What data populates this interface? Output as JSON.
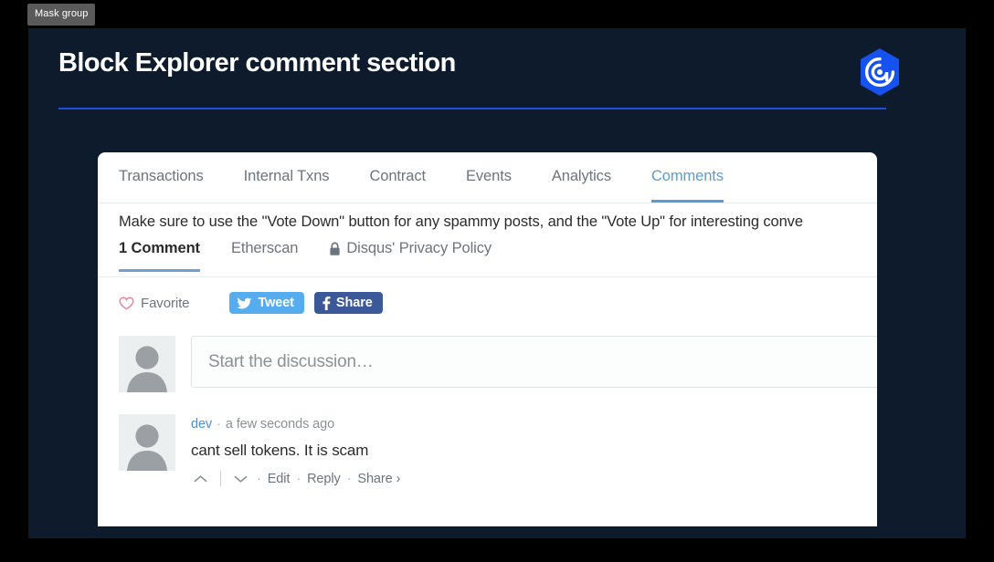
{
  "tooltip": {
    "label": "Mask group"
  },
  "panel": {
    "title": "Block Explorer comment section",
    "background_color": "#0d1b2d",
    "rule_color": "#1d4ed8",
    "logo_name": "brand-hexagon-logo",
    "logo_color": "#1652f0"
  },
  "card": {
    "tabs": [
      {
        "label": "Transactions",
        "active": false
      },
      {
        "label": "Internal Txns",
        "active": false
      },
      {
        "label": "Contract",
        "active": false
      },
      {
        "label": "Events",
        "active": false
      },
      {
        "label": "Analytics",
        "active": false
      },
      {
        "label": "Comments",
        "active": true
      }
    ],
    "active_tab_color": "#5b9bd5",
    "notice": "Make sure to use the \"Vote Down\" button for any spammy posts, and the \"Vote Up\" for interesting conve",
    "disqus_header": {
      "comment_count": "1 Comment",
      "site_name": "Etherscan",
      "privacy_policy": "Disqus' Privacy Policy"
    },
    "share_row": {
      "favorite_label": "Favorite",
      "tweet_label": "Tweet",
      "facebook_label": "Share",
      "tweet_color": "#55acee",
      "facebook_color": "#3b5998",
      "heart_color": "#e8869b"
    },
    "composer": {
      "placeholder": "Start the discussion…"
    },
    "comment": {
      "author": "dev",
      "meta_separator": "·",
      "timestamp": "a few seconds ago",
      "text": "cant sell tokens. It is scam",
      "actions": {
        "edit": "Edit",
        "reply": "Reply",
        "share": "Share ›"
      }
    }
  }
}
